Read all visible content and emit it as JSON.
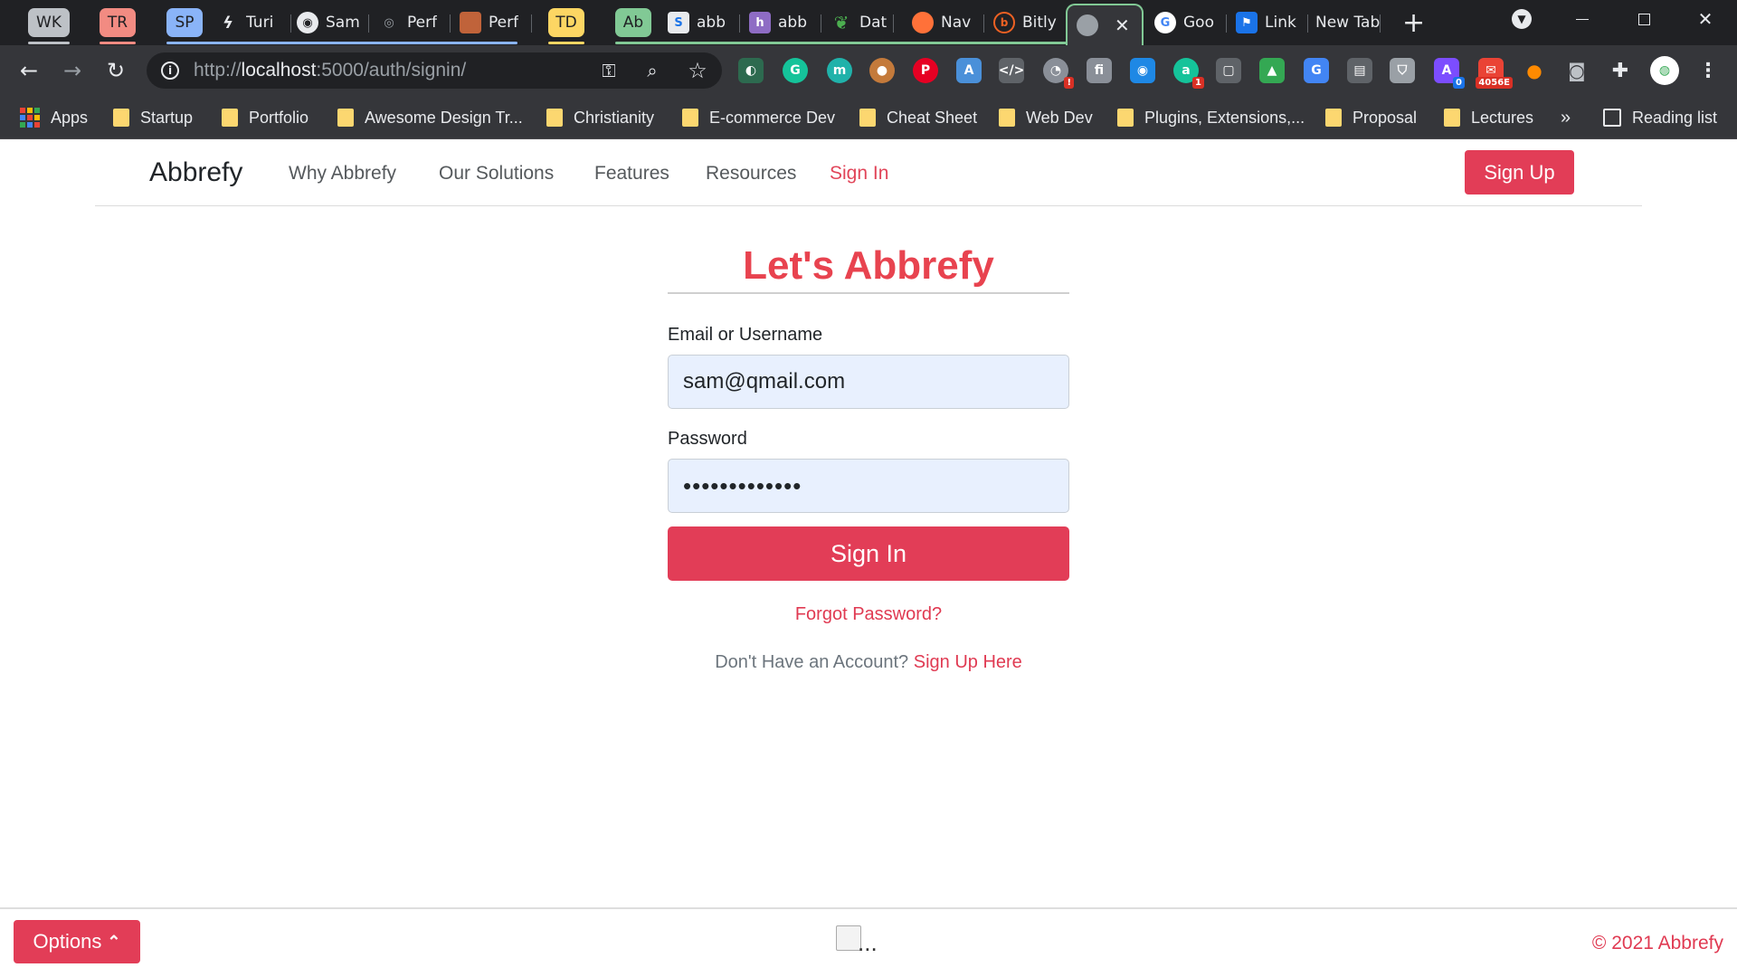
{
  "browser": {
    "tabs": [
      {
        "label": "WK",
        "kind": "group",
        "color": "#bdc1c6"
      },
      {
        "label": "TR",
        "kind": "group",
        "color": "#f28b82"
      },
      {
        "label": "SP",
        "kind": "group",
        "color": "#8ab4f8"
      },
      {
        "label": "Turi",
        "kind": "tab",
        "icon": "lightning-icon"
      },
      {
        "label": "Sam",
        "kind": "tab",
        "icon": "github-icon"
      },
      {
        "label": "Perf",
        "kind": "tab",
        "icon": "globe-icon"
      },
      {
        "label": "Perf",
        "kind": "tab",
        "icon": "image-icon"
      },
      {
        "label": "TD",
        "kind": "group",
        "color": "#fdd663"
      },
      {
        "label": "Ab",
        "kind": "group",
        "color": "#81c995"
      },
      {
        "label": "abb",
        "kind": "tab",
        "icon": "s-icon"
      },
      {
        "label": "abb",
        "kind": "tab",
        "icon": "heroku-icon"
      },
      {
        "label": "Dat",
        "kind": "tab",
        "icon": "mongodb-leaf-icon"
      },
      {
        "label": "Nav",
        "kind": "tab",
        "icon": "firefox-icon"
      },
      {
        "label": "Bitly",
        "kind": "tab",
        "icon": "bitly-icon"
      },
      {
        "label": "",
        "kind": "active",
        "icon": "globe-icon"
      },
      {
        "label": "Goo",
        "kind": "tab",
        "icon": "google-icon"
      },
      {
        "label": "Link",
        "kind": "tab",
        "icon": "flag-icon"
      },
      {
        "label": "New Tab",
        "kind": "tab",
        "icon": ""
      }
    ],
    "new_tab_symbol": "+",
    "url_prefix": "http://",
    "url_host": "localhost",
    "url_rest": ":5000/auth/signin/",
    "bookmarks": [
      {
        "label": "Apps",
        "kind": "apps"
      },
      {
        "label": "Startup",
        "kind": "folder"
      },
      {
        "label": "Portfolio",
        "kind": "folder"
      },
      {
        "label": "Awesome Design Tr...",
        "kind": "folder"
      },
      {
        "label": "Christianity",
        "kind": "folder"
      },
      {
        "label": "E-commerce Dev",
        "kind": "folder"
      },
      {
        "label": "Cheat Sheet",
        "kind": "folder"
      },
      {
        "label": "Web Dev",
        "kind": "folder"
      },
      {
        "label": "Plugins, Extensions,...",
        "kind": "folder"
      },
      {
        "label": "Proposal",
        "kind": "folder"
      },
      {
        "label": "Lectures",
        "kind": "folder"
      }
    ],
    "overflow_label": "»",
    "reading_list_label": "Reading list",
    "extension_badges": {
      "notif": "!",
      "grammarly": "1",
      "count": "0",
      "mail": "4056E"
    }
  },
  "site": {
    "brand": "Abbrefy",
    "nav": [
      {
        "label": "Why Abbrefy"
      },
      {
        "label": "Our Solutions"
      },
      {
        "label": "Features"
      },
      {
        "label": "Resources"
      },
      {
        "label": "Sign In",
        "active": true
      }
    ],
    "signup_button": "Sign Up"
  },
  "form": {
    "title": "Let's Abbrefy",
    "email_label": "Email or Username",
    "email_value": "sam@qmail.com",
    "password_label": "Password",
    "password_value": "•••••••••••••",
    "submit_label": "Sign In",
    "forgot_label": "Forgot Password?",
    "no_account_text": "Don't Have an Account?",
    "signup_link": "Sign Up Here"
  },
  "footer": {
    "options_label": "Options",
    "options_caret": "⌃",
    "loading_dots": "...",
    "copyright": "© 2021 Abbrefy"
  },
  "colors": {
    "accent": "#e23d57",
    "title": "#e8434f",
    "input_bg": "#e8f0fe"
  }
}
